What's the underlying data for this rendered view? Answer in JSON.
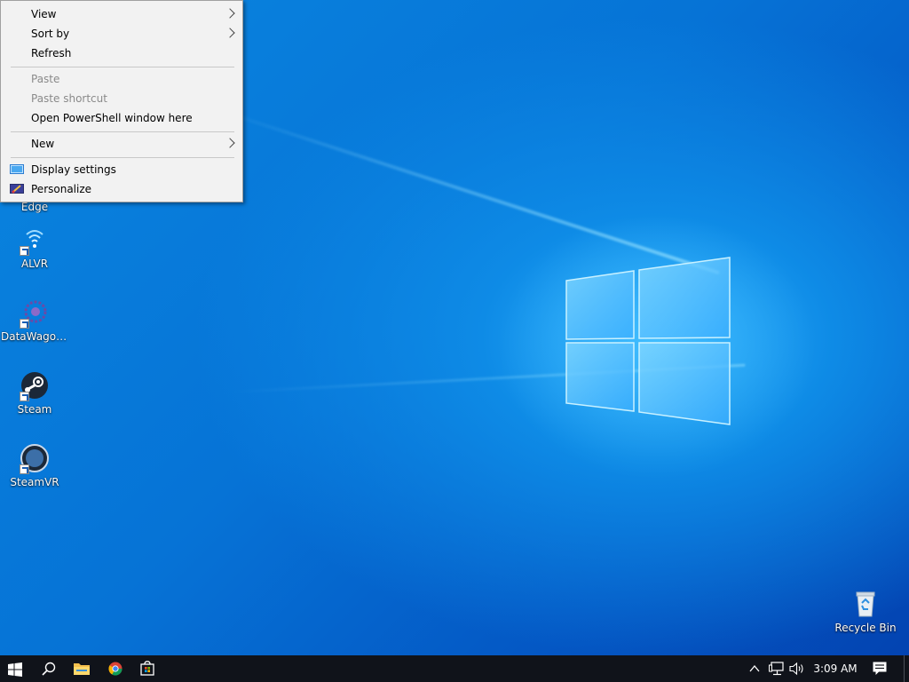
{
  "desktop": {
    "icons": [
      {
        "label": "Edge"
      },
      {
        "label": "ALVR"
      },
      {
        "label": "DataWagon..."
      },
      {
        "label": "Steam"
      },
      {
        "label": "SteamVR"
      },
      {
        "label": "Recycle Bin"
      }
    ]
  },
  "context_menu": {
    "items": [
      {
        "label": "View",
        "enabled": true,
        "submenu": true
      },
      {
        "label": "Sort by",
        "enabled": true,
        "submenu": true
      },
      {
        "label": "Refresh",
        "enabled": true
      },
      {
        "label": "Paste",
        "enabled": false
      },
      {
        "label": "Paste shortcut",
        "enabled": false
      },
      {
        "label": "Open PowerShell window here",
        "enabled": true
      },
      {
        "label": "New",
        "enabled": true,
        "submenu": true
      },
      {
        "label": "Display settings",
        "enabled": true,
        "icon": "display-icon"
      },
      {
        "label": "Personalize",
        "enabled": true,
        "icon": "personalize-icon"
      }
    ]
  },
  "taskbar": {
    "clock": "3:09 AM",
    "pinned": [
      "start-icon",
      "search-icon",
      "file-explorer-icon",
      "chrome-icon",
      "store-icon"
    ],
    "tray": [
      "chevron-up-icon",
      "network-icon",
      "volume-icon",
      "notification-icon"
    ]
  },
  "colors": {
    "accent": "#0078d7",
    "taskbar": "#10131a",
    "menu_bg": "#f2f2f2"
  }
}
